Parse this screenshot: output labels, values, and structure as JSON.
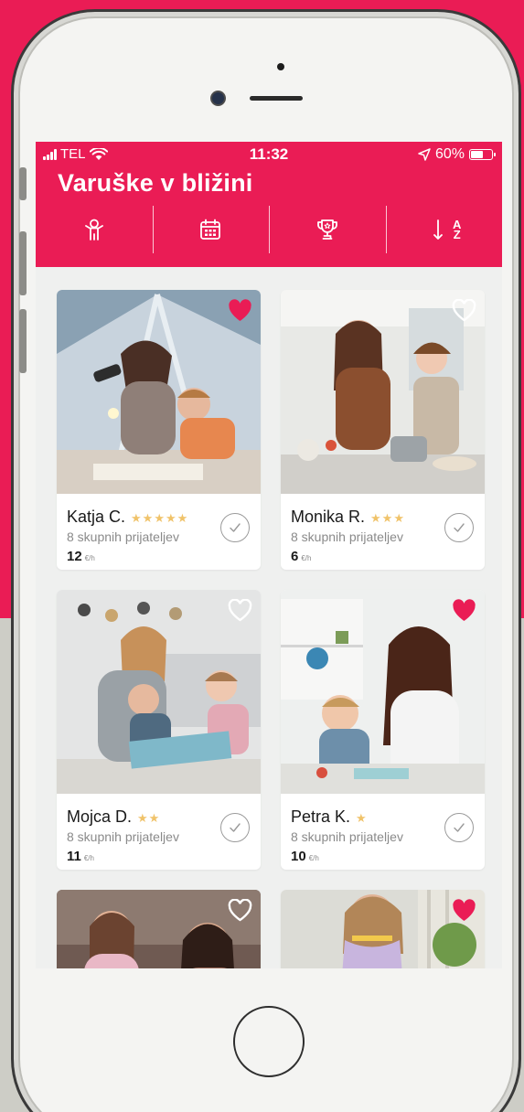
{
  "status_bar": {
    "carrier": "TEL",
    "time": "11:32",
    "battery": "60%",
    "battery_level": 0.6
  },
  "header": {
    "title": "Varuške v bližini"
  },
  "toolbar": {
    "items": [
      {
        "icon": "person-icon"
      },
      {
        "icon": "calendar-icon"
      },
      {
        "icon": "trophy-icon"
      },
      {
        "icon": "sort-az-icon",
        "top": "A",
        "bottom": "Z"
      }
    ]
  },
  "colors": {
    "accent": "#ea1c55",
    "star": "#f0c36a",
    "background": "#eff0ef"
  },
  "cards": [
    {
      "name": "Katja C.",
      "stars": "★★★★★",
      "friends": "8 skupnih prijateljev",
      "price": "12",
      "unit": "€/h",
      "favorite": true
    },
    {
      "name": "Monika R.",
      "stars": "★★★",
      "friends": "8 skupnih prijateljev",
      "price": "6",
      "unit": "€/h",
      "favorite": false
    },
    {
      "name": "Mojca D.",
      "stars": "★★",
      "friends": "8 skupnih prijateljev",
      "price": "11",
      "unit": "€/h",
      "favorite": false
    },
    {
      "name": "Petra K.",
      "stars": "★",
      "friends": "8 skupnih prijateljev",
      "price": "10",
      "unit": "€/h",
      "favorite": true
    },
    {
      "favorite": false
    },
    {
      "favorite": true
    }
  ]
}
